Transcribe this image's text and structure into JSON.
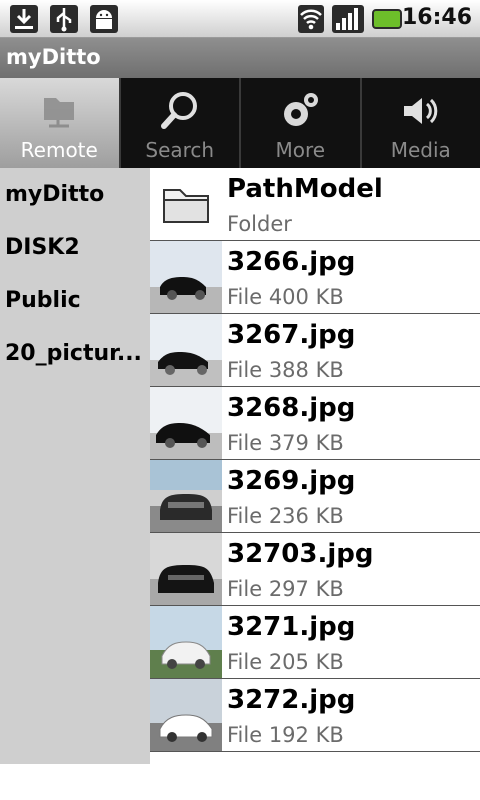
{
  "status_bar": {
    "icons": [
      "download-icon",
      "usb-icon",
      "android-debug-icon",
      "wifi-icon",
      "signal-icon",
      "battery-icon"
    ],
    "time": "16:46"
  },
  "title_bar": {
    "title": "myDitto"
  },
  "tabs": [
    {
      "label": "Remote",
      "icon": "folder-network-icon",
      "active": true
    },
    {
      "label": "Search",
      "icon": "magnifier-icon",
      "active": false
    },
    {
      "label": "More",
      "icon": "gears-icon",
      "active": false
    },
    {
      "label": "Media",
      "icon": "speaker-icon",
      "active": false
    }
  ],
  "sidebar": {
    "items": [
      {
        "label": "myDitto"
      },
      {
        "label": "DISK2"
      },
      {
        "label": "Public"
      },
      {
        "label": "20_pictur..."
      }
    ]
  },
  "list": {
    "items": [
      {
        "name": "PathModel",
        "meta": "Folder",
        "type": "folder"
      },
      {
        "name": "3266.jpg",
        "meta": "File 400 KB",
        "type": "image"
      },
      {
        "name": "3267.jpg",
        "meta": "File 388 KB",
        "type": "image"
      },
      {
        "name": "3268.jpg",
        "meta": "File 379 KB",
        "type": "image"
      },
      {
        "name": "3269.jpg",
        "meta": "File 236 KB",
        "type": "image"
      },
      {
        "name": "32703.jpg",
        "meta": "File 297 KB",
        "type": "image"
      },
      {
        "name": "3271.jpg",
        "meta": "File 205 KB",
        "type": "image"
      },
      {
        "name": "3272.jpg",
        "meta": "File 192 KB",
        "type": "image"
      }
    ]
  },
  "colors": {
    "title_bar": "#7f7f7f",
    "tab_bar": "#111111",
    "tab_active": "#bdbdbd",
    "sidebar": "#cfcfcf",
    "battery": "#6dbe2a"
  }
}
